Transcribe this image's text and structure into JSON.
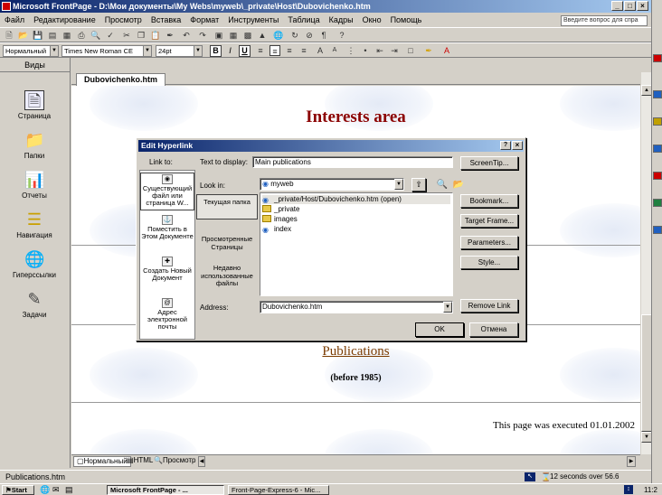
{
  "window": {
    "title": "Microsoft FrontPage - D:\\Мои документы\\My Webs\\myweb\\_private\\Host\\Dubovichenko.htm",
    "min": "_",
    "max": "×",
    "close": "×"
  },
  "menu": {
    "items": [
      "Файл",
      "Редактирование",
      "Просмотр",
      "Вставка",
      "Формат",
      "Инструменты",
      "Таблица",
      "Кадры",
      "Окно",
      "Помощь"
    ],
    "help_placeholder": "Введите вопрос для спра"
  },
  "format_bar": {
    "style": "Нормальный",
    "font": "Times New Roman CE",
    "size": "24pt",
    "bold": "B",
    "italic": "I",
    "underline": "U"
  },
  "views": {
    "header": "Виды",
    "items": [
      "Страница",
      "Папки",
      "Отчеты",
      "Навигация",
      "Гиперссылки",
      "Задачи"
    ]
  },
  "doc": {
    "tab": "Dubovichenko.htm",
    "heading": "Interests area",
    "link": "Publications",
    "subtext": "(before 1985)",
    "footer": "This page was executed 01.01.2002"
  },
  "view_tabs": [
    "Нормальный",
    "HTML",
    "Просмотр"
  ],
  "status": {
    "left": "Publications.htm",
    "right": "12 seconds over 56.6"
  },
  "taskbar": {
    "start": "Start",
    "tasks": [
      "Microsoft FrontPage - ...",
      "Front-Page-Express-6 - Mic..."
    ],
    "clock": "11:2"
  },
  "dialog": {
    "title": "Edit Hyperlink",
    "title_buttons": [
      "?",
      "×"
    ],
    "link_to": "Link to:",
    "link_options": [
      "Существующий файл или страница W...",
      "Поместить в Этом Документе",
      "Создать Новый Документ",
      "Адрес электронной почты"
    ],
    "text_to_display_label": "Text to display:",
    "text_to_display": "Main publications",
    "screentip": "ScreenTip...",
    "look_in_label": "Look in:",
    "look_in": "myweb",
    "places": [
      "Текущая папка",
      "Просмотренные Страницы",
      "Недавно использованные файлы"
    ],
    "files": [
      "_private/Host/Dubovichenko.htm (open)",
      "_private",
      "images",
      "index"
    ],
    "buttons": [
      "Bookmark...",
      "Target Frame...",
      "Parameters...",
      "Style..."
    ],
    "address_label": "Address:",
    "address": "Dubovichenko.htm",
    "remove_link": "Remove Link",
    "ok": "OK",
    "cancel": "Отмена"
  },
  "colors": {
    "heading": "#8b0000",
    "link": "#7a3b00",
    "title_dark": "#0a246a",
    "title_light": "#a6caf0"
  }
}
